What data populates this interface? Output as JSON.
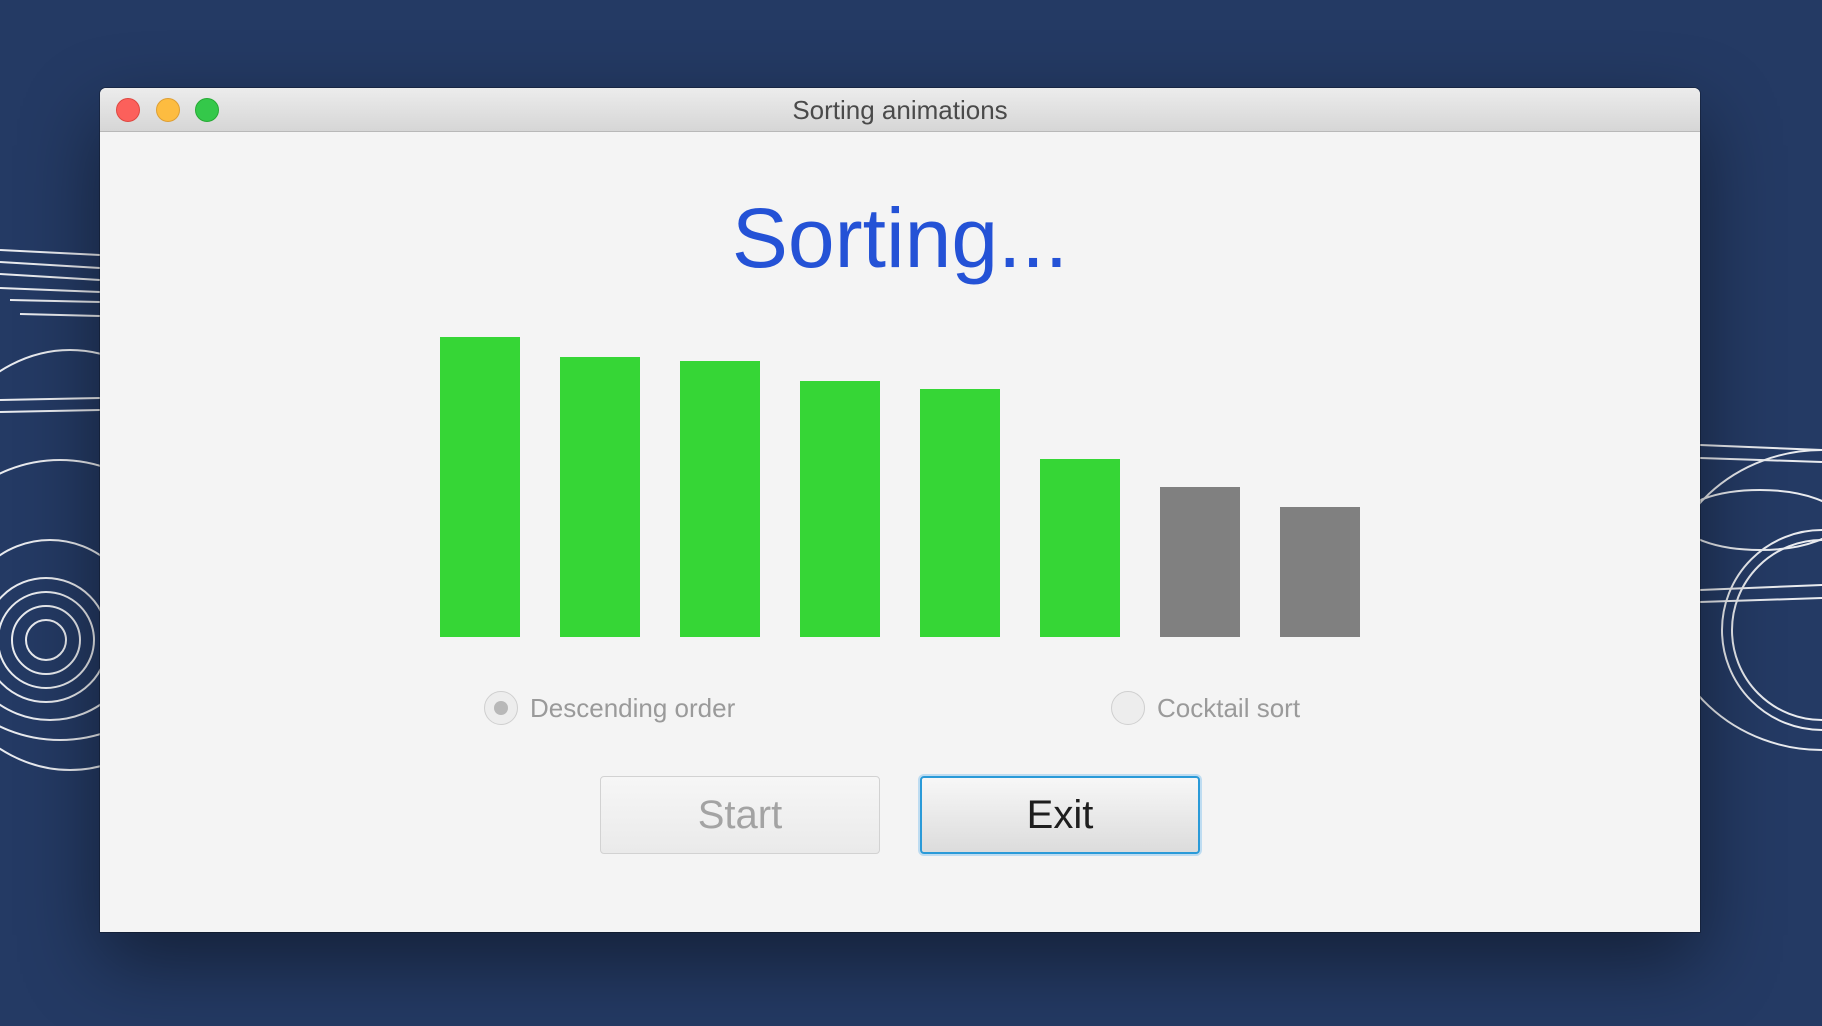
{
  "window": {
    "title": "Sorting animations"
  },
  "heading": "Sorting...",
  "options": {
    "descending_label": "Descending order",
    "descending_selected": true,
    "cocktail_label": "Cocktail sort",
    "cocktail_selected": false
  },
  "buttons": {
    "start_label": "Start",
    "start_enabled": false,
    "exit_label": "Exit",
    "exit_focused": true
  },
  "colors": {
    "heading": "#2452d6",
    "sorted_bar": "#36d636",
    "unsorted_bar": "#808080",
    "focus_ring": "#2a9ad8"
  },
  "chart_data": {
    "type": "bar",
    "values": [
      300,
      280,
      276,
      256,
      248,
      178,
      150,
      130
    ],
    "status": [
      "sorted",
      "sorted",
      "sorted",
      "sorted",
      "sorted",
      "sorted",
      "unsorted",
      "unsorted"
    ],
    "ylim": [
      0,
      300
    ]
  }
}
